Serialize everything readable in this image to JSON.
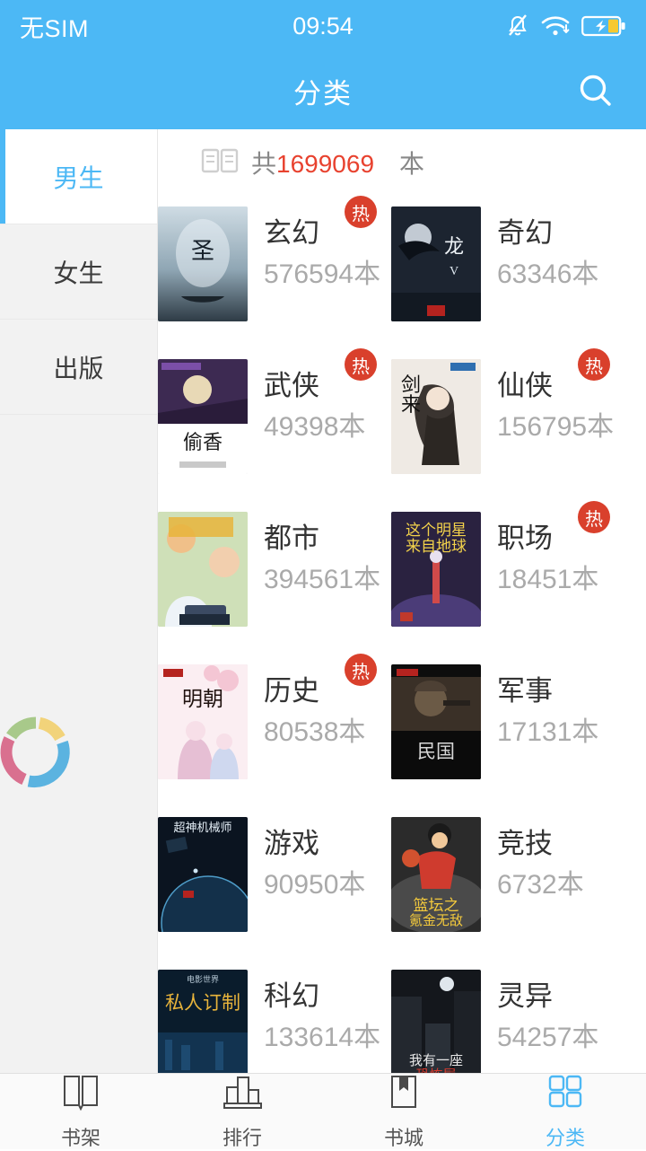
{
  "status": {
    "carrier": "无SIM",
    "time": "09:54",
    "icons": [
      "bell-muted-icon",
      "wifi-icon",
      "battery-charging-icon"
    ]
  },
  "titlebar": {
    "title": "分类",
    "search_icon": "search-icon"
  },
  "sidebar": {
    "items": [
      {
        "label": "男生",
        "active": true
      },
      {
        "label": "女生",
        "active": false
      },
      {
        "label": "出版",
        "active": false
      }
    ],
    "loader_colors": [
      "#d9708f",
      "#a8c98a",
      "#f2d37a",
      "#5bb3e0"
    ]
  },
  "count_bar": {
    "icon": "open-book-icon",
    "prefix": "共",
    "total": "1699069",
    "unit": "本"
  },
  "colors": {
    "accent": "#4cb8f5",
    "hot_badge": "#d9402c",
    "count_number": "#e8422f",
    "muted_text": "#aaaaaa"
  },
  "categories": [
    {
      "name": "玄幻",
      "count": "576594本",
      "hot": true,
      "cover": "sheng-xu"
    },
    {
      "name": "奇幻",
      "count": "63346本",
      "hot": false,
      "cover": "long-zu"
    },
    {
      "name": "武侠",
      "count": "49398本",
      "hot": true,
      "cover": "tou-xiang"
    },
    {
      "name": "仙侠",
      "count": "156795本",
      "hot": true,
      "cover": "jian-lai"
    },
    {
      "name": "都市",
      "count": "394561本",
      "hot": false,
      "cover": "xiu-zhen"
    },
    {
      "name": "职场",
      "count": "18451本",
      "hot": true,
      "cover": "ming-xing"
    },
    {
      "name": "历史",
      "count": "80538本",
      "hot": true,
      "cover": "ming-chao"
    },
    {
      "name": "军事",
      "count": "17131本",
      "hot": false,
      "cover": "min-guo"
    },
    {
      "name": "游戏",
      "count": "90950本",
      "hot": false,
      "cover": "chao-shen"
    },
    {
      "name": "竞技",
      "count": "6732本",
      "hot": false,
      "cover": "lan-tan"
    },
    {
      "name": "科幻",
      "count": "133614本",
      "hot": false,
      "cover": "si-ren"
    },
    {
      "name": "灵异",
      "count": "54257本",
      "hot": false,
      "cover": "kong-bu"
    }
  ],
  "tabbar": {
    "items": [
      {
        "label": "书架",
        "icon": "bookshelf-icon",
        "active": false
      },
      {
        "label": "排行",
        "icon": "ranking-chart-icon",
        "active": false
      },
      {
        "label": "书城",
        "icon": "bookstore-icon",
        "active": false
      },
      {
        "label": "分类",
        "icon": "grid-category-icon",
        "active": true
      }
    ]
  }
}
